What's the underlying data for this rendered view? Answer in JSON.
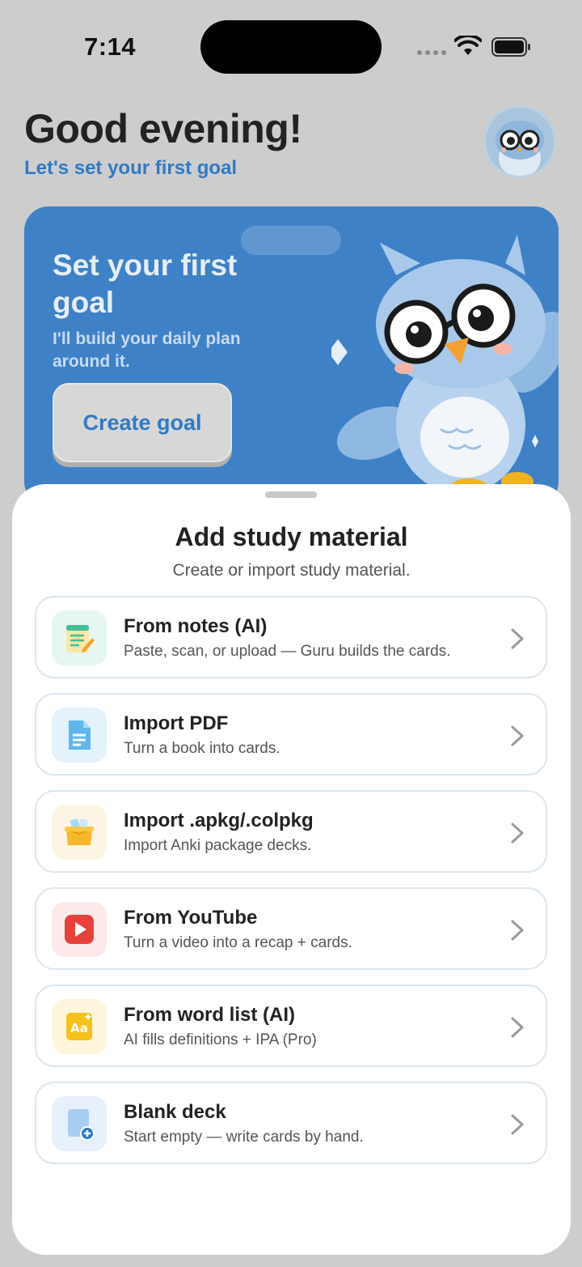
{
  "status_bar": {
    "time": "7:14"
  },
  "header": {
    "greeting": "Good evening!",
    "subtitle": "Let's set your first goal"
  },
  "hero": {
    "title": "Set your first goal",
    "description": "I'll build your daily plan around it.",
    "button_label": "Create goal"
  },
  "sheet": {
    "title": "Add study material",
    "subtitle": "Create or import study material.",
    "options": [
      {
        "title": "From notes (AI)",
        "description": "Paste, scan, or upload — Guru builds the cards.",
        "icon": "notes-icon",
        "icon_bg": "#e6f7f1"
      },
      {
        "title": "Import PDF",
        "description": "Turn a book into cards.",
        "icon": "pdf-document-icon",
        "icon_bg": "#e3f2fb"
      },
      {
        "title": "Import .apkg/.colpkg",
        "description": "Import Anki package decks.",
        "icon": "package-box-icon",
        "icon_bg": "#fdf5e3"
      },
      {
        "title": "From YouTube",
        "description": "Turn a video into a recap + cards.",
        "icon": "youtube-play-icon",
        "icon_bg": "#fde9e9"
      },
      {
        "title": "From word list (AI)",
        "description": "AI fills definitions + IPA (Pro)",
        "icon": "word-list-icon",
        "icon_bg": "#fdf6dc"
      },
      {
        "title": "Blank deck",
        "description": "Start empty — write cards by hand.",
        "icon": "blank-deck-icon",
        "icon_bg": "#e7f0fb"
      }
    ]
  },
  "colors": {
    "accent": "#2f7ac4",
    "hero_bg": "#3f81c7",
    "screen_dim": "#cdcdcd"
  }
}
